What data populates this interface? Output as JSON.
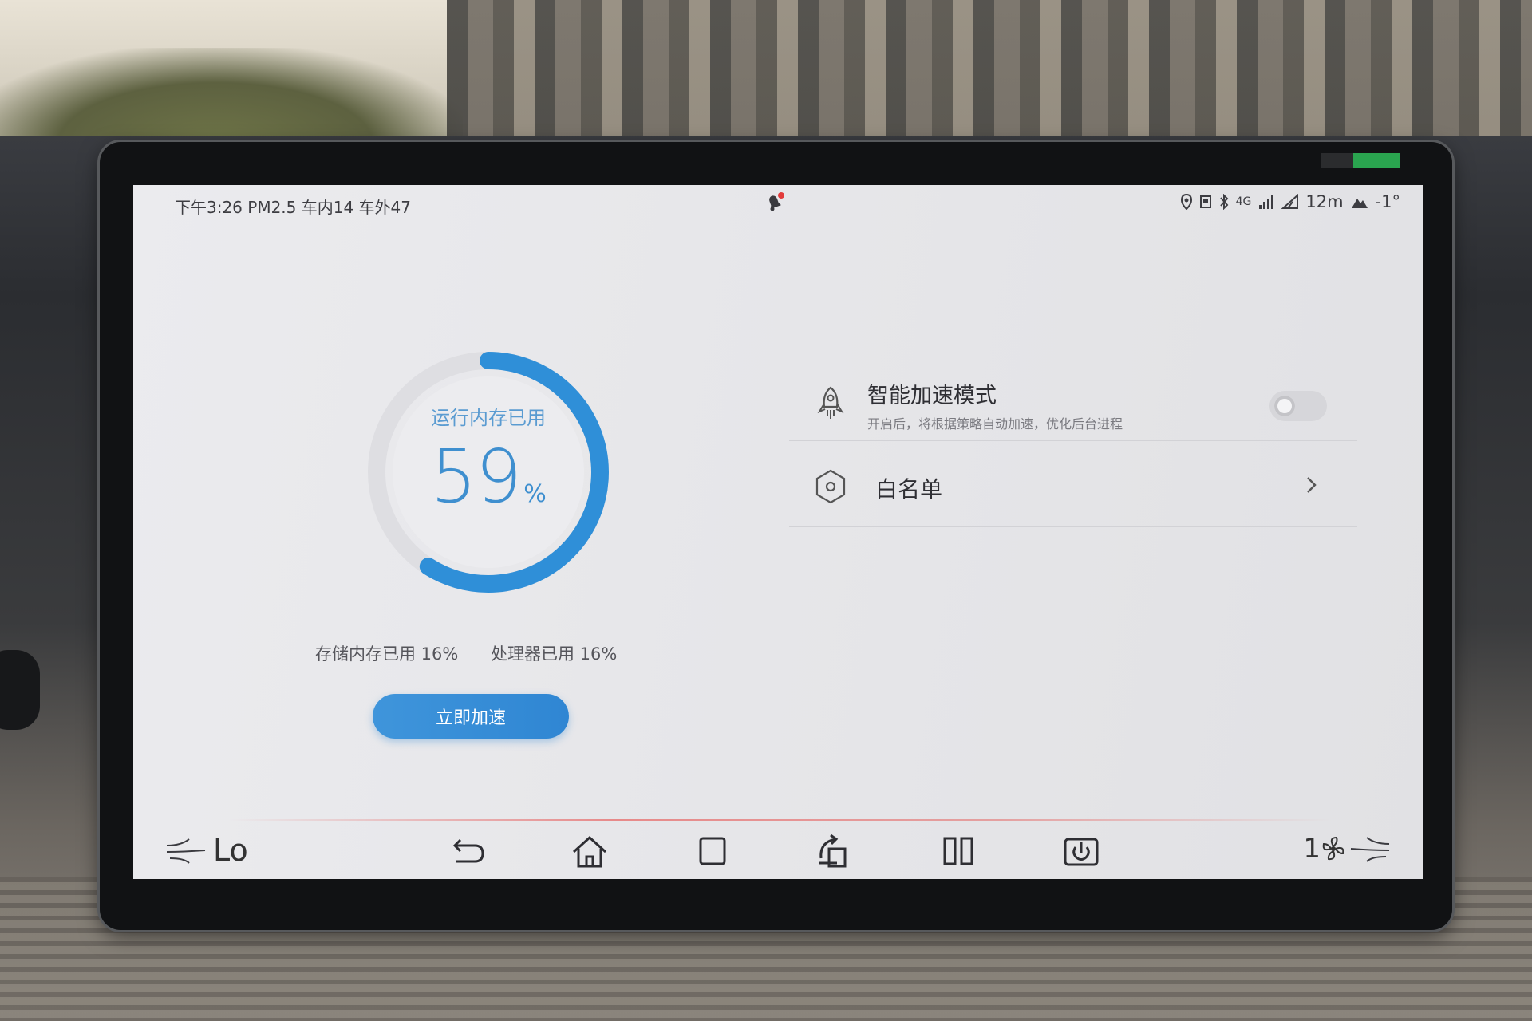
{
  "status_bar": {
    "left_text": "下午3:26 PM2.5 车内14 车外47",
    "signal_label": "4G",
    "distance": "12m",
    "temperature": "-1°"
  },
  "memory": {
    "label": "运行内存已用",
    "value": "59",
    "unit": "%",
    "fraction": 0.59,
    "storage_text": "存储内存已用 16%",
    "cpu_text": "处理器已用 16%",
    "boost_label": "立即加速"
  },
  "settings": {
    "smart_mode": {
      "title": "智能加速模式",
      "description": "开启后，将根据策略自动加速，优化后台进程",
      "enabled": false
    },
    "whitelist": {
      "title": "白名单"
    }
  },
  "navbar": {
    "ac_mode": "Lo",
    "fan_speed": "1",
    "buttons": [
      "back-icon",
      "home-icon",
      "recent-apps-icon",
      "rotate-screen-icon",
      "split-screen-icon",
      "power-icon"
    ]
  },
  "colors": {
    "accent": "#2f8fd8",
    "ring_track": "#e0e0e4",
    "screen_bg": "#e7e7ea"
  }
}
